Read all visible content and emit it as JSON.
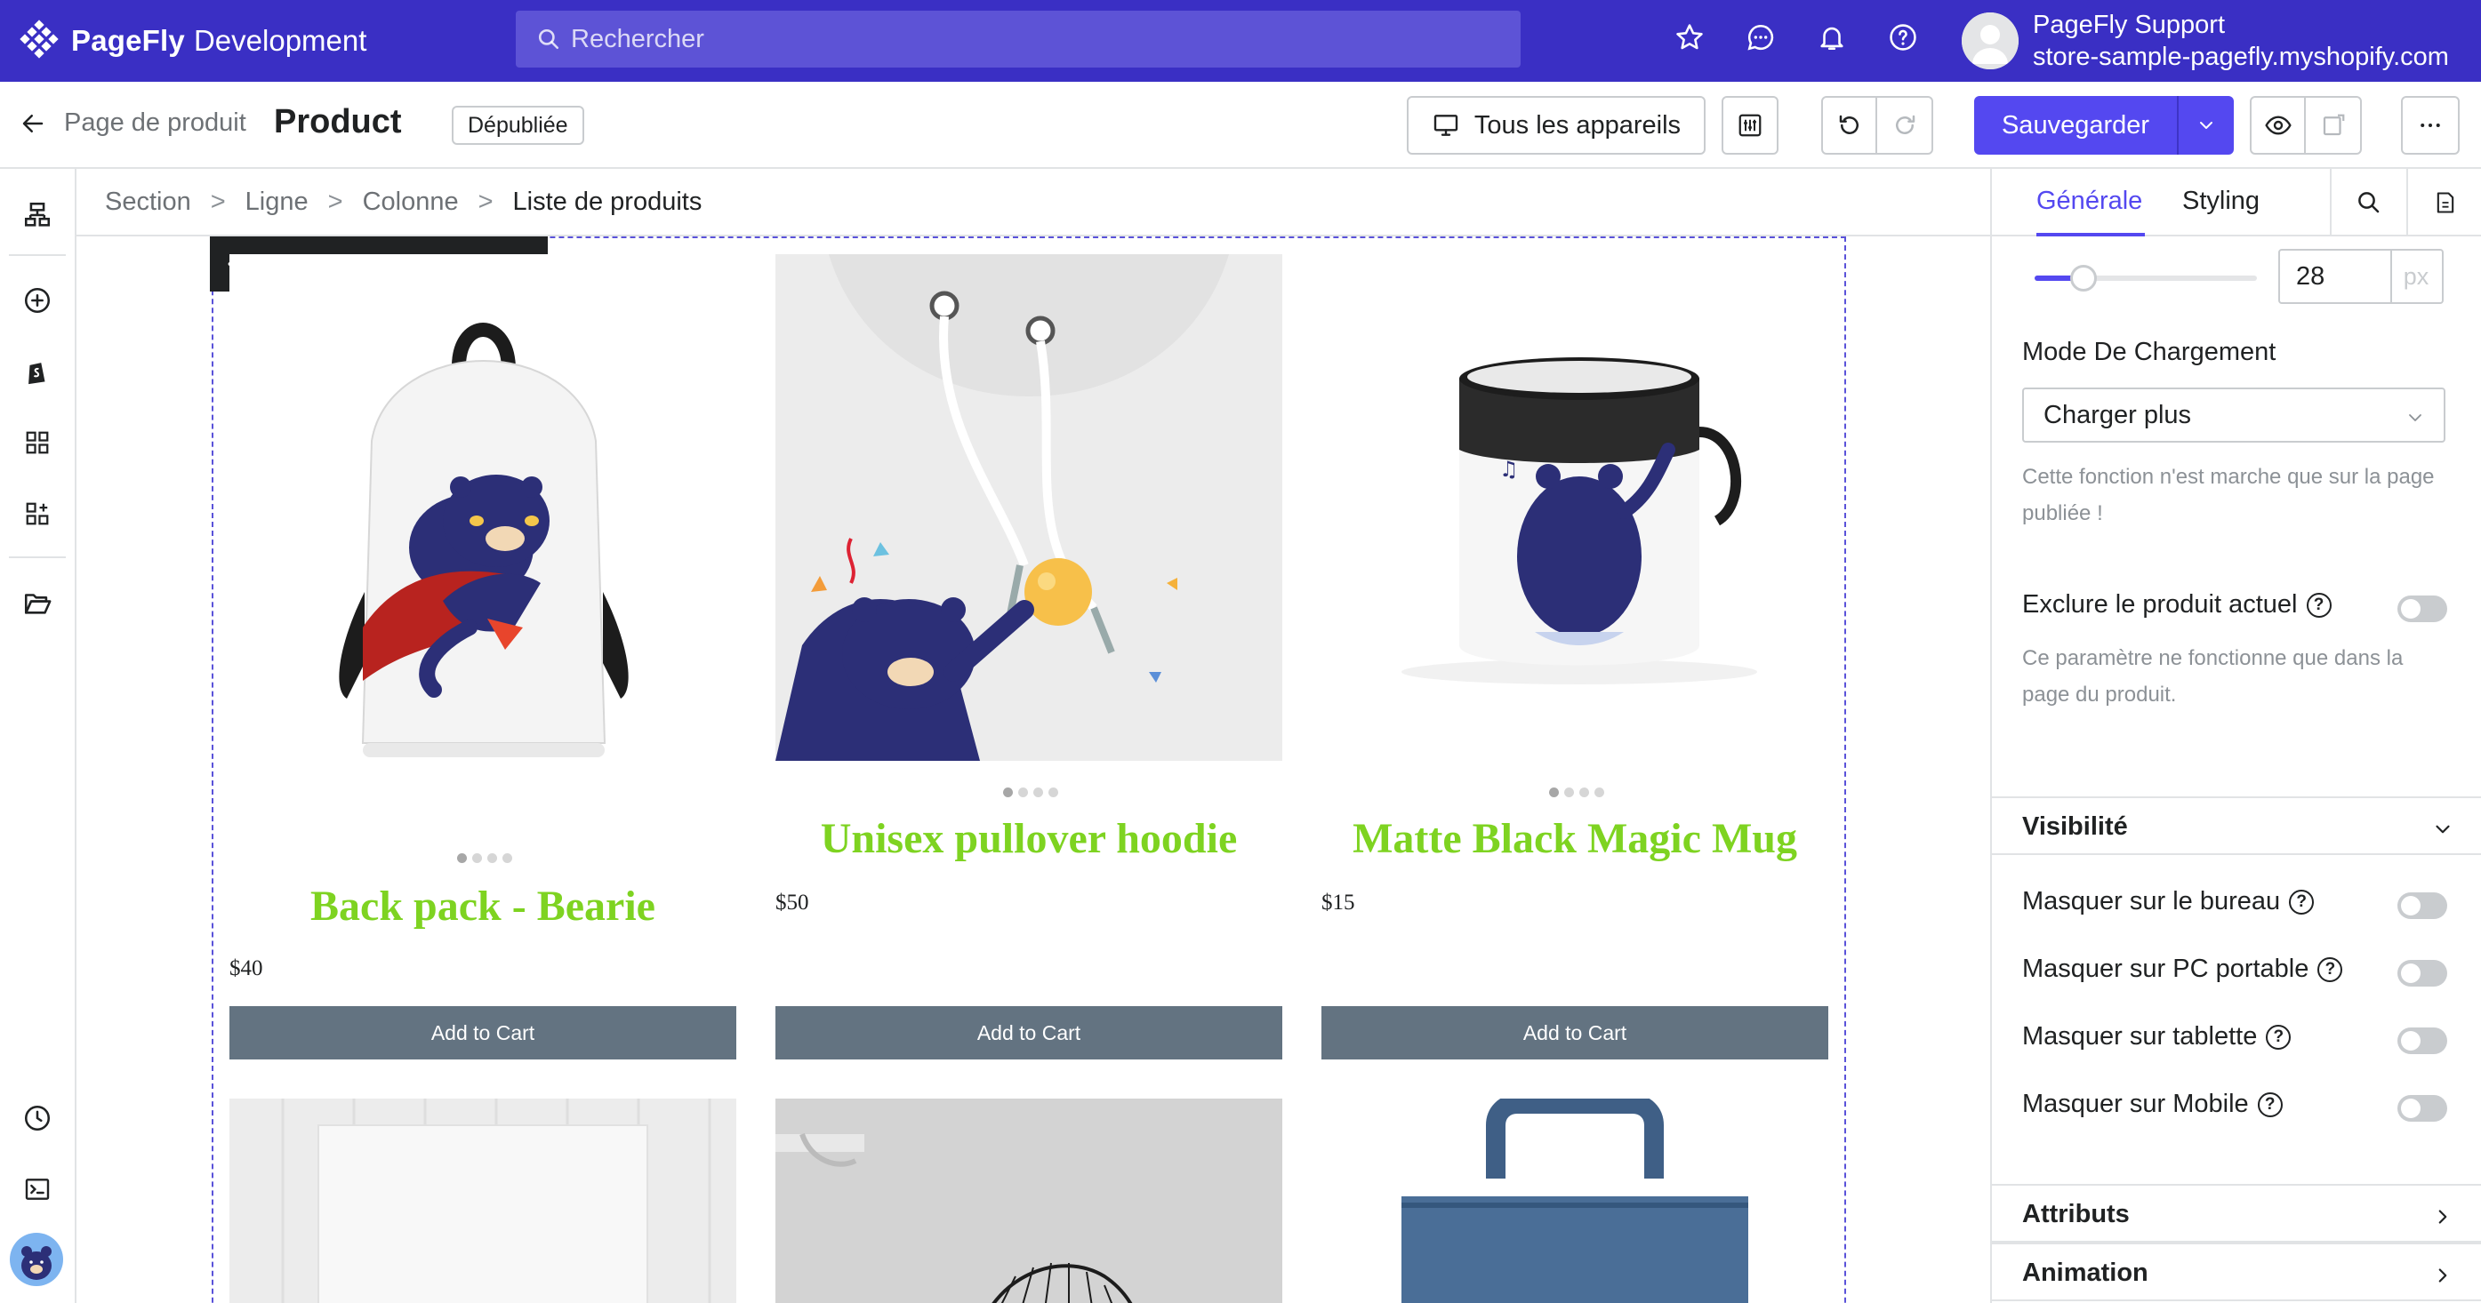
{
  "app": {
    "brand": "PageFly",
    "brand_sub": "Development",
    "search_placeholder": "Rechercher",
    "user_name": "PageFly Support",
    "user_store": "store-sample-pagefly.myshopify.com"
  },
  "toolbar": {
    "back_label": "Page de produit",
    "page_title": "Product",
    "status": "Dépubliée",
    "device_label": "Tous les appareils",
    "save_label": "Sauvegarder"
  },
  "breadcrumb": [
    "Section",
    "Ligne",
    "Colonne",
    "Liste de produits"
  ],
  "products": [
    {
      "title": "Back pack - Bearie",
      "price": "$40",
      "button": "Add to Cart"
    },
    {
      "title": "Unisex pullover hoodie",
      "price": "$50",
      "button": "Add to Cart"
    },
    {
      "title": "Matte Black Magic Mug",
      "price": "$15",
      "button": "Add to Cart"
    }
  ],
  "panel": {
    "tabs": [
      "Générale",
      "Styling"
    ],
    "size_value": "28",
    "size_unit": "px",
    "slider_fraction": 0.22,
    "loading_mode_label": "Mode De Chargement",
    "loading_mode_value": "Charger plus",
    "loading_help": "Cette fonction n'est marche que sur la page publiée !",
    "exclude_label": "Exclure le produit actuel",
    "exclude_help": "Ce paramètre ne fonctionne que dans la page du produit.",
    "visibility_title": "Visibilité",
    "visibility_items": [
      "Masquer sur le bureau",
      "Masquer sur PC portable",
      "Masquer sur tablette",
      "Masquer sur Mobile"
    ],
    "attributes_title": "Attributs",
    "animation_title": "Animation"
  },
  "colors": {
    "topbar": "#3a2fc4",
    "accent": "#5448f0",
    "product_title": "#7ed321",
    "add_to_cart": "#637381"
  }
}
